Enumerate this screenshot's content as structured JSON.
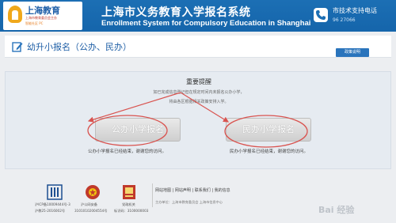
{
  "header": {
    "logo_title": "上海教育",
    "logo_sub1": "上海市教育委员会主办",
    "logo_sub2": "智能社区 PC",
    "system_title": "上海市义务教育入学报名系统",
    "system_subtitle": "Enrollment System for Compulsory Education in Shanghai",
    "support_label": "市技术支持电话",
    "support_number": "96 27066"
  },
  "page": {
    "title": "幼升小报名（公办、民办）",
    "policy_button": "政策说明"
  },
  "notice": {
    "title": "重要提醒",
    "line1": "如已完成信息登记但在规定时间内未报名公办小学，",
    "line2": "将由各区根据相关政策安排入学。"
  },
  "registration": {
    "public_button": "公办小学报名",
    "public_note": "公办小学报名已经结束，谢谢您的访问。",
    "private_button": "民办小学报名",
    "private_note": "民办小学报名已经结束，谢谢您的访问。"
  },
  "footer": {
    "badge1_caption": "沪ICP备10009444号-3",
    "badge1_caption2": "沪教25-2016002号",
    "badge2_caption": "沪公网安备",
    "badge2_caption2": "31010102004554号",
    "badge3_caption": "党政机关",
    "badge3_caption2": "标识码：3100000003",
    "links": "网站地图 | 网站声明 | 联系我们 | 我的信息",
    "address": "主办单位：上海市教育委员会 上海市信息中心"
  },
  "watermark": "Bai 经验",
  "colors": {
    "header_blue": "#1c6fb4",
    "annotation_red": "#d9534f"
  }
}
